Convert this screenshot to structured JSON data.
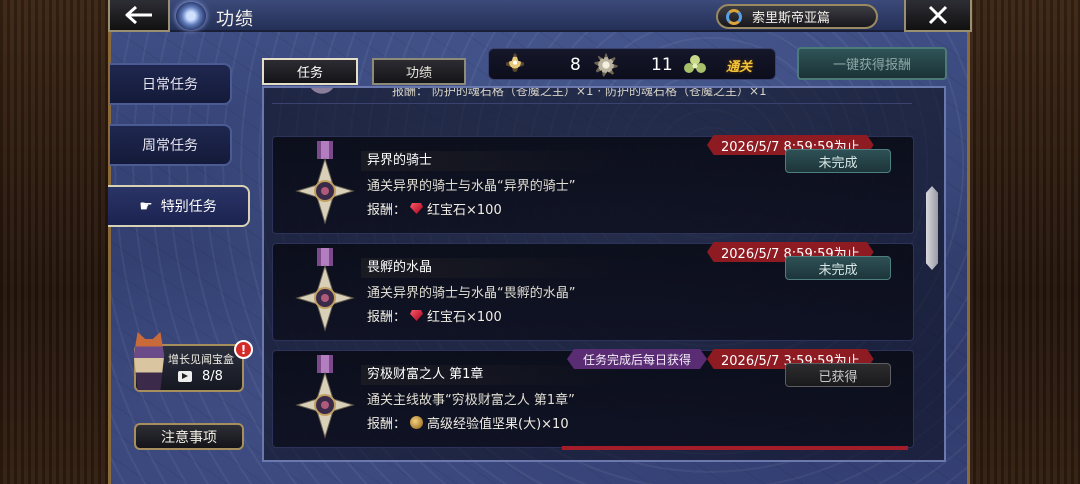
{
  "header": {
    "title": "功绩",
    "region": "索里斯帝亚篇"
  },
  "nav": {
    "items": [
      {
        "label": "日常任务"
      },
      {
        "label": "周常任务"
      },
      {
        "label": "特别任务",
        "active": true
      }
    ]
  },
  "treasure_box": {
    "label": "增长见闻宝盒",
    "count": "8/8",
    "alert": "!"
  },
  "notice_button": "注意事项",
  "tabs": [
    {
      "label": "任务",
      "active": true
    },
    {
      "label": "功绩"
    }
  ],
  "stats": {
    "medal_count": "8",
    "badge_count": "11",
    "clear_label": "通关"
  },
  "claim_all_label": "一键获得报酬",
  "partial_row_text": "报酬： 防护的魂石格（苍魔之主）×1 · 防护的魂石格（苍魔之主）×1",
  "quests": [
    {
      "name": "异界的骑士",
      "desc": "通关异界的骑士与水晶“异界的骑士”",
      "reward_label": "报酬：",
      "reward_icon": "ruby-icon",
      "reward": "红宝石×100",
      "deadline": "2026/5/7  8:59:59为止",
      "status": "未完成"
    },
    {
      "name": "畏孵的水晶",
      "desc": "通关异界的骑士与水晶“畏孵的水晶”",
      "reward_label": "报酬：",
      "reward_icon": "ruby-icon",
      "reward": "红宝石×100",
      "deadline": "2026/5/7  8:59:59为止",
      "status": "未完成"
    },
    {
      "name": "穷极财富之人  第1章",
      "desc": "通关主线故事“穷极财富之人  第1章”",
      "reward_label": "报酬：",
      "reward_icon": "nut-icon",
      "reward": "高级经验值坚果(大)×10",
      "deadline": "2026/5/7  3:59:59为止",
      "daily_note": "任务完成后每日获得",
      "status": "已获得"
    }
  ],
  "colors": {
    "deadline_bg": "#8e1a22",
    "daily_note_bg": "#5a2c73",
    "status_incomplete": "#2e5156",
    "clear_gold": "#f2c43a"
  }
}
